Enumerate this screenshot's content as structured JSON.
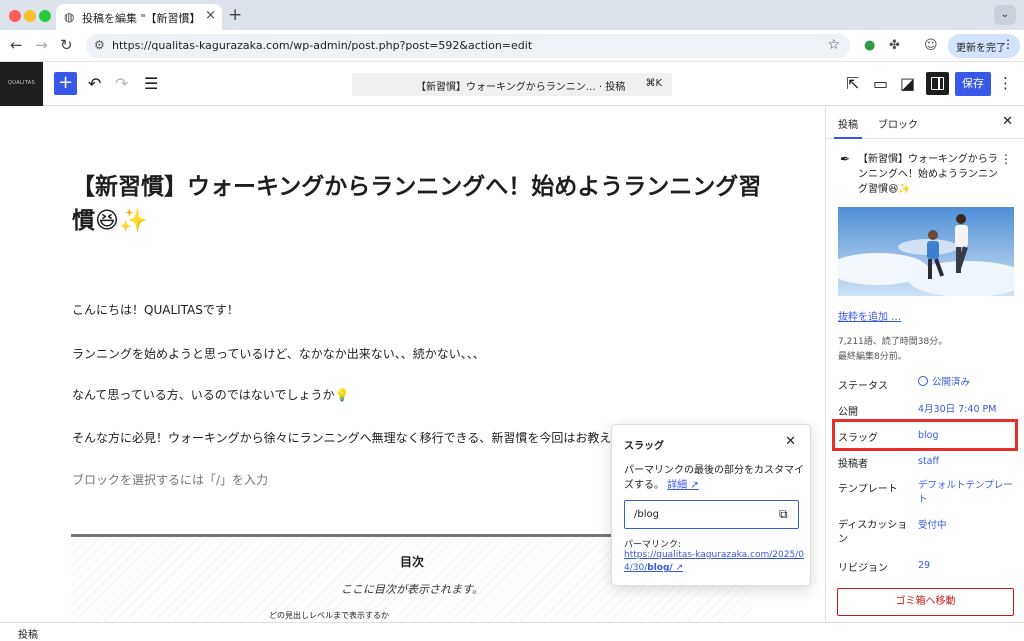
{
  "browser": {
    "tab_title": "投稿を編集 \"【新習慣】ウォーキ",
    "url": "https://qualitas-kagurazaka.com/wp-admin/post.php?post=592&action=edit",
    "update_label": "更新を完了"
  },
  "toolbar": {
    "site_logo": "QUALITAS",
    "doc_title": "【新習慣】ウォーキングからランニン…  · 投稿",
    "shortcut": "⌘K",
    "save_label": "保存"
  },
  "post": {
    "title": "【新習慣】ウォーキングからランニングへ！始めようランニング習慣😆✨",
    "paragraphs": [
      "こんにちは！QUALITASです！",
      "ランニングを始めようと思っているけど、なかなか出来ない、、続かない、、、",
      "なんて思っている方、いるのではないでしょうか💡",
      "そんな方に必見！ウォーキングから徐々にランニングへ無理なく移行できる、新習慣を今回はお教えします"
    ],
    "block_placeholder": "ブロックを選択するには「/」を入力",
    "toc": {
      "title": "目次",
      "subtitle": "ここに目次が表示されます。",
      "level_text": "どの見出しレベルまで表示するか"
    }
  },
  "slug_popover": {
    "title": "スラッグ",
    "help": "パーマリンクの最後の部分をカスタマイズする。",
    "help_link": "詳細 ↗",
    "value": "/blog",
    "permalink_label": "パーマリンク:",
    "permalink_pre": "https://qualitas-kagurazaka.com/2025/04/30/",
    "permalink_slug": "blog/",
    "permalink_arrow": " ↗"
  },
  "sidebar": {
    "tabs": [
      "投稿",
      "ブロック"
    ],
    "post_name": "【新習慣】ウォーキングからランニングへ！始めようランニング習慣😆✨",
    "excerpt_link": "抜粋を追加 …",
    "word_count": "7,211語、読了時間38分。",
    "last_edited": "最終編集8分前。",
    "rows": [
      {
        "label": "ステータス",
        "value": "公開済み"
      },
      {
        "label": "公開",
        "value": "4月30日 7:40 PM"
      },
      {
        "label": "スラッグ",
        "value": "blog"
      },
      {
        "label": "投稿者",
        "value": "staff"
      },
      {
        "label": "テンプレート",
        "value": "デフォルトテンプレート"
      },
      {
        "label": "ディスカッション",
        "value": "受付中"
      },
      {
        "label": "リビジョン",
        "value": "29"
      }
    ],
    "trash_label": "ゴミ箱へ移動"
  },
  "footer": {
    "breadcrumb": "投稿"
  },
  "colors": {
    "accent": "#3858e9",
    "highlight": "#e63026",
    "danger": "#cc1818"
  }
}
